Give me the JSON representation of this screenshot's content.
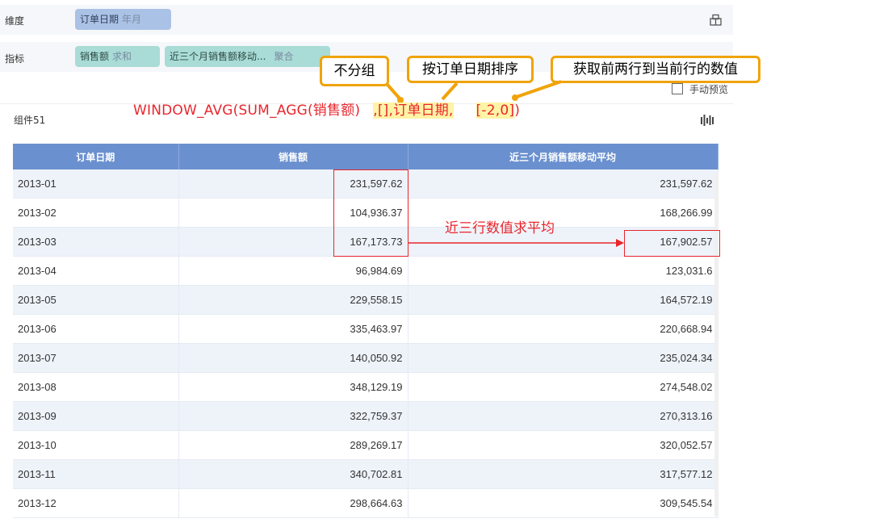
{
  "dimension_shelf": {
    "label": "维度",
    "pill_name": "订单日期",
    "pill_sub": "年月"
  },
  "measure_shelf": {
    "label": "指标",
    "pill1_name": "销售额",
    "pill1_sub": "求和",
    "pill2_name": "近三个月销售额移动...",
    "pill2_sub": "聚合"
  },
  "callouts": {
    "no_group": "不分组",
    "sort_by_date": "按订单日期排序",
    "get_rows": "获取前两行到当前行的数值"
  },
  "formula": {
    "part1": "WINDOW_AVG(SUM_AGG(销售额)",
    "part2": ",[]",
    "part3": ",订单日期,",
    "part4": "[-2,0]",
    "part5": ")"
  },
  "manual_preview": "手动预览",
  "component": {
    "title": "组件51",
    "columns": [
      "订单日期",
      "销售额",
      "近三个月销售额移动平均"
    ],
    "rows": [
      [
        "2013-01",
        "231,597.62",
        "231,597.62"
      ],
      [
        "2013-02",
        "104,936.37",
        "168,266.99"
      ],
      [
        "2013-03",
        "167,173.73",
        "167,902.57"
      ],
      [
        "2013-04",
        "96,984.69",
        "123,031.6"
      ],
      [
        "2013-05",
        "229,558.15",
        "164,572.19"
      ],
      [
        "2013-06",
        "335,463.97",
        "220,668.94"
      ],
      [
        "2013-07",
        "140,050.92",
        "235,024.34"
      ],
      [
        "2013-08",
        "348,129.19",
        "274,548.02"
      ],
      [
        "2013-09",
        "322,759.37",
        "270,313.16"
      ],
      [
        "2013-10",
        "289,269.17",
        "320,052.57"
      ],
      [
        "2013-11",
        "340,702.81",
        "317,577.12"
      ],
      [
        "2013-12",
        "298,664.63",
        "309,545.54"
      ]
    ]
  },
  "annotation_note": "近三行数值求平均",
  "colors": {
    "header": "#6a90cf",
    "callout_border": "#f0a30a",
    "annotation": "#e8262d"
  }
}
